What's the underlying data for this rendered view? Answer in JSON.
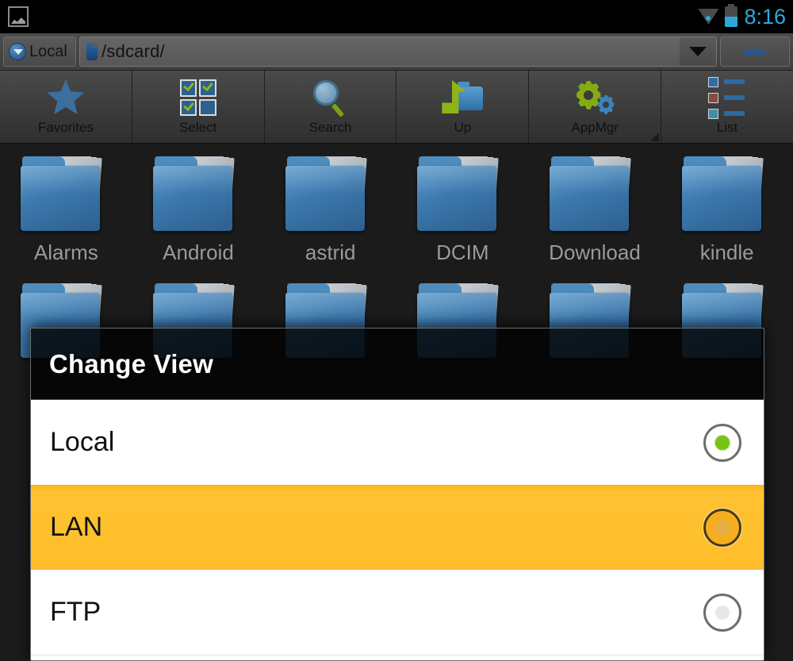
{
  "statusbar": {
    "notification_icon": "screenshot-icon",
    "wifi_icon": "wifi-icon",
    "battery_icon": "battery-icon",
    "time": "8:16",
    "accent_color": "#2ea8d8"
  },
  "addressbar": {
    "location_button": "Local",
    "location_icon": "blue-dropdown-circle-icon",
    "path_icon": "sdcard-icon",
    "path": "/sdcard/",
    "dropdown_icon": "caret-down-icon",
    "minimize_icon": "minimize-icon"
  },
  "toolbar": {
    "buttons": [
      {
        "label": "Favorites",
        "icon": "star-icon"
      },
      {
        "label": "Select",
        "icon": "checkbox-grid-icon"
      },
      {
        "label": "Search",
        "icon": "magnifier-icon"
      },
      {
        "label": "Up",
        "icon": "up-arrow-folder-icon"
      },
      {
        "label": "AppMgr",
        "icon": "gears-icon"
      },
      {
        "label": "List",
        "icon": "list-view-icon"
      }
    ]
  },
  "files": {
    "row1": [
      "Alarms",
      "Android",
      "astrid",
      "DCIM",
      "Download",
      "kindle"
    ],
    "row2": [
      "",
      "",
      "",
      "",
      "",
      ""
    ]
  },
  "dialog": {
    "title": "Change View",
    "highlight_color": "#ffbe2a",
    "selected_radio_color": "#76c413",
    "options": [
      {
        "label": "Local",
        "selected": true,
        "highlighted": false
      },
      {
        "label": "LAN",
        "selected": false,
        "highlighted": true
      },
      {
        "label": "FTP",
        "selected": false,
        "highlighted": false
      }
    ]
  }
}
